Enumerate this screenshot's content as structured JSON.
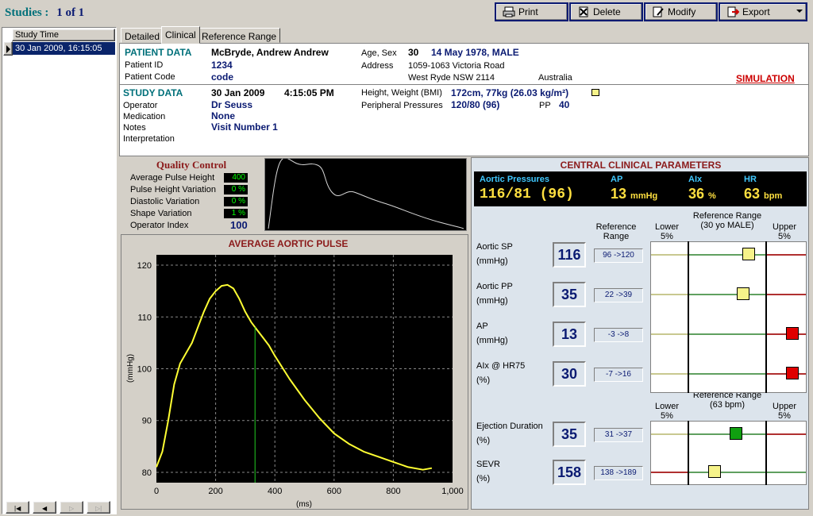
{
  "app": {
    "studies_label": "Studies :",
    "studies_count": "1 of 1"
  },
  "toolbar": {
    "print": "Print",
    "delete": "Delete",
    "modify": "Modify",
    "export": "Export"
  },
  "study_list": {
    "header": "Study Time",
    "selected": "30 Jan 2009, 16:15:05"
  },
  "tabs": [
    "Detailed",
    "Clinical",
    "Reference Range"
  ],
  "patient": {
    "section": "PATIENT DATA",
    "name": "McBryde, Andrew Andrew",
    "id_label": "Patient ID",
    "id": "1234",
    "code_label": "Patient Code",
    "code": "code",
    "age_sex_label": "Age, Sex",
    "age": "30",
    "dob_sex": "14 May 1978, MALE",
    "address_label": "Address",
    "address1": "1059-1063 Victoria Road",
    "address2": "West Ryde NSW 2114",
    "country": "Australia",
    "simulation": "SIMULATION"
  },
  "study": {
    "section": "STUDY DATA",
    "date": "30 Jan 2009",
    "time": "4:15:05 PM",
    "operator_label": "Operator",
    "operator": "Dr Seuss",
    "medication_label": "Medication",
    "medication": "None",
    "notes_label": "Notes",
    "notes": "Visit Number 1",
    "interpretation_label": "Interpretation",
    "hw_label": "Height, Weight (BMI)",
    "hw": "172cm, 77kg (26.03 kg/m²)",
    "pp_label": "Peripheral Pressures",
    "pp": "120/80 (96)",
    "pp_short_label": "PP",
    "pp_short": "40"
  },
  "quality": {
    "title": "Quality Control",
    "rows": [
      {
        "label": "Average Pulse Height",
        "value": "400"
      },
      {
        "label": "Pulse Height Variation",
        "value": "0 %"
      },
      {
        "label": "Diastolic Variation",
        "value": "0 %"
      },
      {
        "label": "Shape Variation",
        "value": "1 %"
      }
    ],
    "operator_index_label": "Operator Index",
    "operator_index": "100"
  },
  "chart_data": {
    "type": "line",
    "title": "AVERAGE AORTIC PULSE",
    "xlabel": "(ms)",
    "ylabel": "(mmHg)",
    "xlim": [
      0,
      1000
    ],
    "ylim": [
      78,
      122
    ],
    "xticks": [
      "0",
      "200",
      "400",
      "600",
      "800",
      "1,000"
    ],
    "yticks": [
      "80",
      "90",
      "100",
      "110",
      "120"
    ],
    "grid": true,
    "series": [
      {
        "x": [
          0,
          20,
          40,
          60,
          80,
          100,
          120,
          140,
          160,
          180,
          200,
          220,
          240,
          260,
          280,
          300,
          320,
          340,
          360,
          380,
          400,
          450,
          500,
          550,
          600,
          650,
          700,
          750,
          800,
          850,
          900,
          930
        ],
        "values": [
          81,
          84,
          90,
          97,
          101,
          103,
          105,
          108,
          111,
          113.5,
          115,
          116,
          116.2,
          115.5,
          113.5,
          111,
          109,
          107.5,
          106,
          104.5,
          102.5,
          98,
          94,
          90.5,
          87.5,
          85.5,
          84,
          83,
          82,
          81,
          80.5,
          80.8
        ]
      }
    ],
    "marker_x": 333
  },
  "central": {
    "title": "CENTRAL CLINICAL PARAMETERS",
    "aortic_label": "Aortic Pressures",
    "aortic_value": "116/81 (96)",
    "ap_label": "AP",
    "ap_value": "13",
    "ap_unit": "mmHg",
    "aix_label": "AIx",
    "aix_value": "36",
    "aix_unit": "%",
    "hr_label": "HR",
    "hr_value": "63",
    "hr_unit": "bpm"
  },
  "params": {
    "ref_range_header": "Reference Range",
    "lower_header": "Lower 5%",
    "upper_header": "Upper 5%",
    "ref_header_1": "Reference Range (30 yo MALE)",
    "ref_header_2": "Reference Range (63 bpm)",
    "rows": [
      {
        "label": "Aortic SP",
        "unit": "(mmHg)",
        "value": "116",
        "range": "96 ->120",
        "status": "yellow"
      },
      {
        "label": "Aortic PP",
        "unit": "(mmHg)",
        "value": "35",
        "range": "22 ->39",
        "status": "yellow"
      },
      {
        "label": "AP",
        "unit": "(mmHg)",
        "value": "13",
        "range": "-3 ->8",
        "status": "red"
      },
      {
        "label": "AIx @ HR75",
        "unit": "(%)",
        "value": "30",
        "range": "-7 ->16",
        "status": "red"
      },
      {
        "label": "Ejection Duration",
        "unit": "(%)",
        "value": "35",
        "range": "31 ->37",
        "status": "green"
      },
      {
        "label": "SEVR",
        "unit": "(%)",
        "value": "158",
        "range": "138 ->189",
        "status": "yellow"
      }
    ]
  },
  "colors": {
    "accent": "#0a1a72",
    "teal": "#00707a",
    "simulation": "#cc0000",
    "marker_yellow": "#f6f38a",
    "marker_red": "#e00000",
    "marker_green": "#10a010"
  }
}
